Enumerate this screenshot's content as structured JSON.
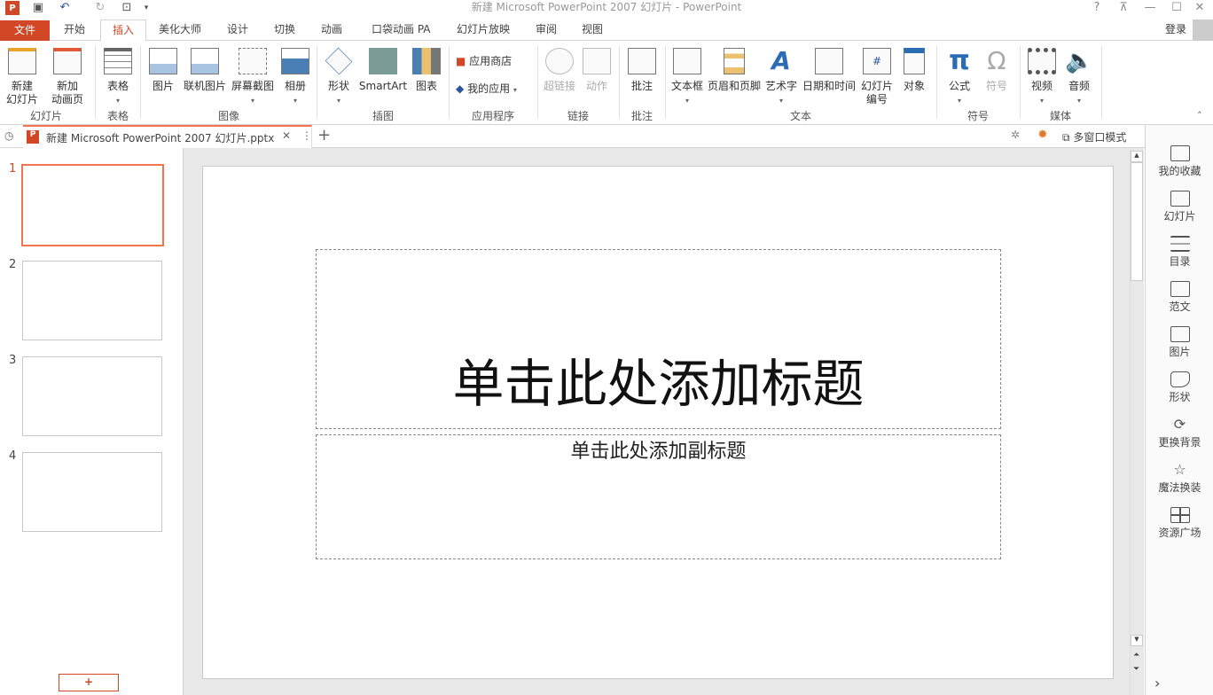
{
  "window": {
    "title": "新建 Microsoft PowerPoint 2007 幻灯片 - PowerPoint",
    "help": "?",
    "signin": "登录"
  },
  "quick_access": {
    "more": "▾"
  },
  "tabs": [
    "文件",
    "开始",
    "插入",
    "美化大师",
    "设计",
    "切换",
    "动画",
    "口袋动画 PA",
    "幻灯片放映",
    "审阅",
    "视图"
  ],
  "ribbon": {
    "groups": [
      {
        "label": "幻灯片",
        "buttons": [
          "新建\n幻灯片",
          "新加\n动画页"
        ]
      },
      {
        "label": "表格",
        "buttons": [
          "表格"
        ]
      },
      {
        "label": "图像",
        "buttons": [
          "图片",
          "联机图片",
          "屏幕截图",
          "相册"
        ]
      },
      {
        "label": "插图",
        "buttons": [
          "形状",
          "SmartArt",
          "图表"
        ]
      },
      {
        "label": "应用程序",
        "buttons": [
          "应用商店",
          "我的应用"
        ]
      },
      {
        "label": "链接",
        "buttons": [
          "超链接",
          "动作"
        ]
      },
      {
        "label": "批注",
        "buttons": [
          "批注"
        ]
      },
      {
        "label": "文本",
        "buttons": [
          "文本框",
          "页眉和页脚",
          "艺术字",
          "日期和时间",
          "幻灯片\n编号",
          "对象"
        ]
      },
      {
        "label": "符号",
        "buttons": [
          "公式",
          "符号"
        ]
      },
      {
        "label": "媒体",
        "buttons": [
          "视频",
          "音频"
        ]
      }
    ]
  },
  "doc_tab": {
    "name": "新建 Microsoft PowerPoint 2007 幻灯片.pptx",
    "multiwindow": "多窗口模式"
  },
  "slides": [
    "1",
    "2",
    "3",
    "4"
  ],
  "add_slide": "+",
  "slide": {
    "title_placeholder": "单击此处添加标题",
    "subtitle_placeholder": "单击此处添加副标题"
  },
  "sidebar": [
    "我的收藏",
    "幻灯片",
    "目录",
    "范文",
    "图片",
    "形状",
    "更换背景",
    "魔法换装",
    "资源广场"
  ],
  "colors": {
    "accent": "#d24726",
    "selection": "#f0744e"
  }
}
